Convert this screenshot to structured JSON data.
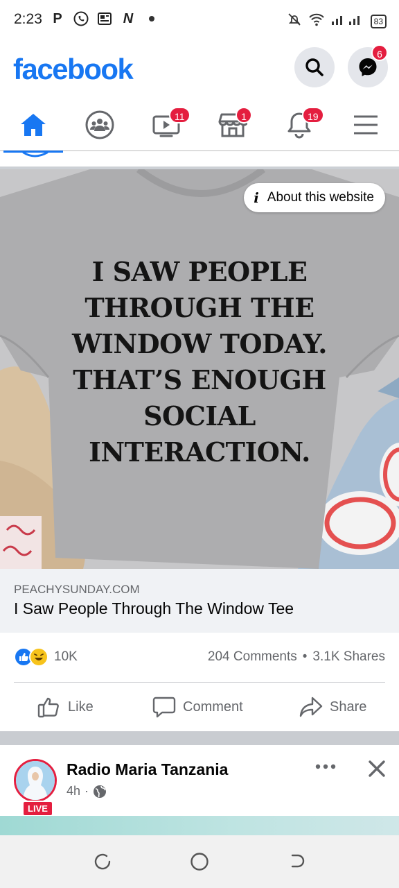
{
  "status_bar": {
    "time": "2:23",
    "left_icons": [
      "p-icon",
      "whatsapp-icon",
      "news-icon",
      "n-icon",
      "dot-icon"
    ],
    "battery": "83"
  },
  "header": {
    "logo": "facebook",
    "messenger_badge": "6"
  },
  "nav_tabs": [
    {
      "name": "home",
      "badge": ""
    },
    {
      "name": "groups",
      "badge": ""
    },
    {
      "name": "watch",
      "badge": "11"
    },
    {
      "name": "marketplace",
      "badge": "1"
    },
    {
      "name": "notifications",
      "badge": "19"
    },
    {
      "name": "menu",
      "badge": ""
    }
  ],
  "ad": {
    "image_text": [
      "I SAW PEOPLE",
      "THROUGH THE",
      "WINDOW TODAY.",
      "THAT’S ENOUGH",
      "SOCIAL",
      "INTERACTION."
    ],
    "about_label": "About this website",
    "domain": "PEACHYSUNDAY.COM",
    "title": "I Saw People Through The Window Tee",
    "reaction_count": "10K",
    "comments": "204 Comments",
    "separator": "•",
    "shares": "3.1K Shares",
    "actions": {
      "like": "Like",
      "comment": "Comment",
      "share": "Share"
    }
  },
  "next_post": {
    "author": "Radio Maria Tanzania",
    "time": "4h",
    "meta_sep": "·",
    "live_label": "LIVE"
  },
  "colors": {
    "brand": "#1877f2",
    "badge": "#e41e3f",
    "muted": "#65676b"
  }
}
